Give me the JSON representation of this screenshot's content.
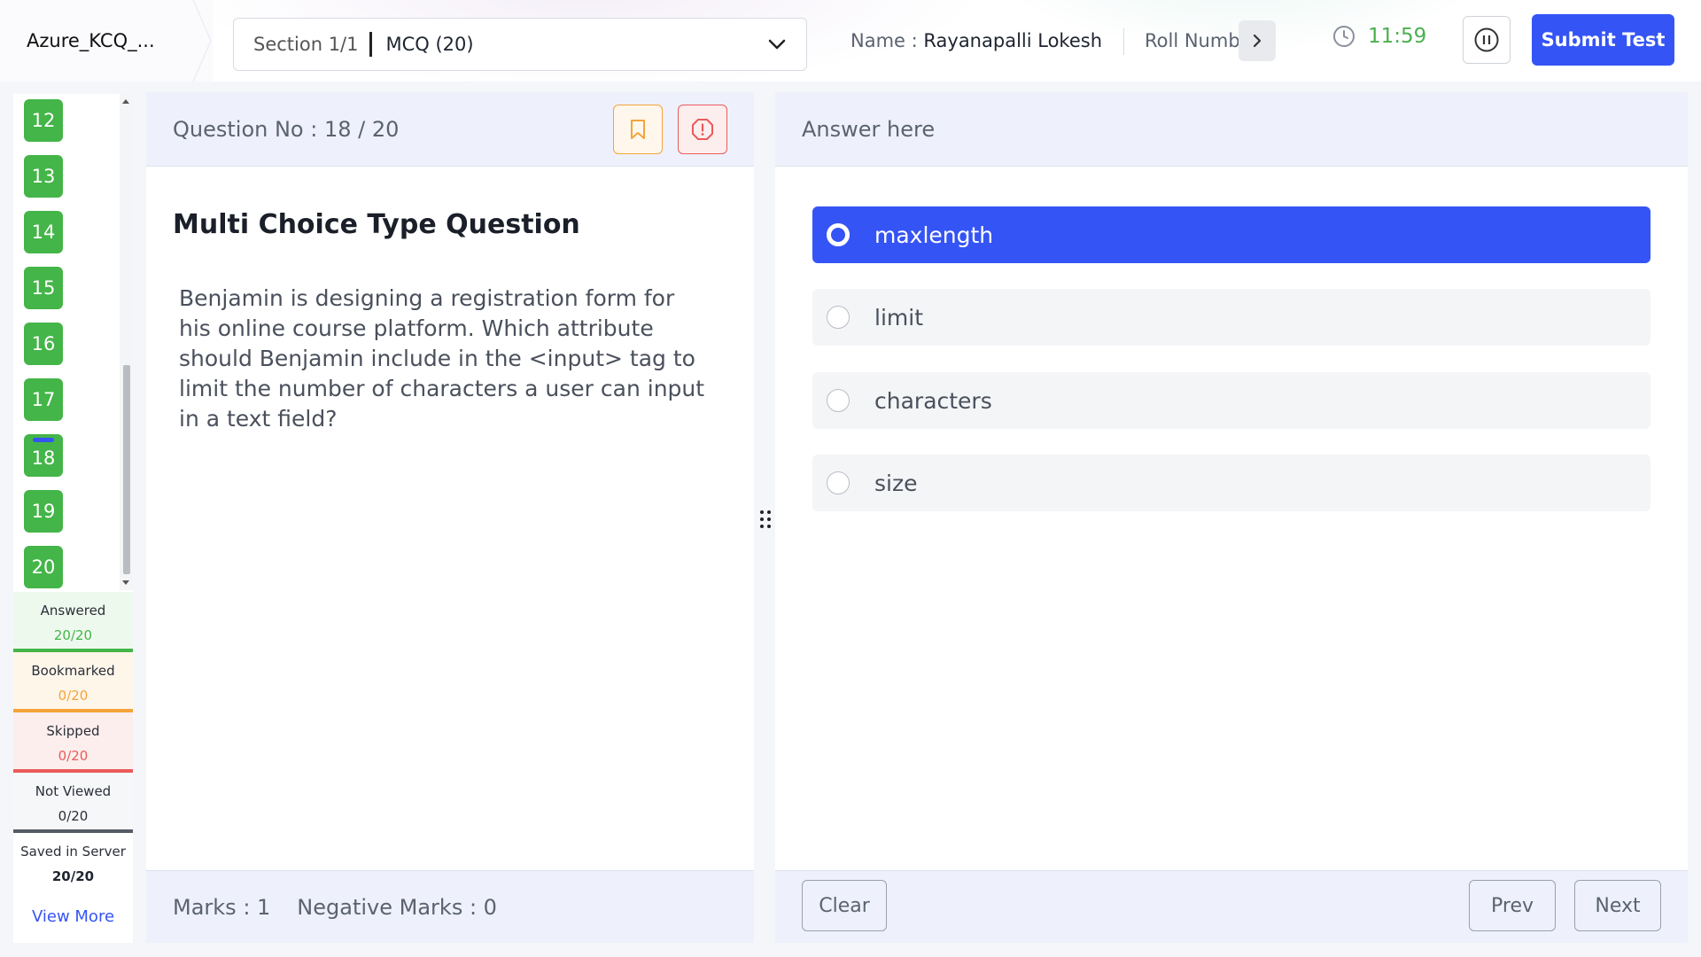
{
  "header": {
    "test_name": "Azure_KCQ_...",
    "section_label": "Section 1/1",
    "section_value": "MCQ (20)",
    "name_label": "Name : ",
    "name_value": "Rayanapalli Lokesh",
    "roll_label": "Roll Number",
    "timer": "11:59",
    "submit_label": "Submit Test"
  },
  "sidebar": {
    "questions": [
      {
        "number": "12",
        "current": false
      },
      {
        "number": "13",
        "current": false
      },
      {
        "number": "14",
        "current": false
      },
      {
        "number": "15",
        "current": false
      },
      {
        "number": "16",
        "current": false
      },
      {
        "number": "17",
        "current": false
      },
      {
        "number": "18",
        "current": true
      },
      {
        "number": "19",
        "current": false
      },
      {
        "number": "20",
        "current": false
      }
    ],
    "stats": {
      "answered": {
        "label": "Answered",
        "value": "20/20"
      },
      "bookmarked": {
        "label": "Bookmarked",
        "value": "0/20"
      },
      "skipped": {
        "label": "Skipped",
        "value": "0/20"
      },
      "not_viewed": {
        "label": "Not Viewed",
        "value": "0/20"
      },
      "saved": {
        "label": "Saved in Server",
        "value": "20/20"
      }
    },
    "view_more": "View More"
  },
  "question": {
    "number_label": "Question No : 18 / 20",
    "type": "Multi Choice Type Question",
    "text": "Benjamin is designing a registration form for his online course platform. Which attribute should Benjamin include in the <input> tag to limit the number of characters a user can input in a text field?",
    "marks": "Marks : 1",
    "negative_marks": "Negative Marks : 0"
  },
  "answer": {
    "title": "Answer here",
    "options": [
      {
        "label": "maxlength",
        "selected": true
      },
      {
        "label": "limit",
        "selected": false
      },
      {
        "label": "characters",
        "selected": false
      },
      {
        "label": "size",
        "selected": false
      }
    ],
    "clear_label": "Clear",
    "prev_label": "Prev",
    "next_label": "Next"
  },
  "colors": {
    "accent": "#3554f5",
    "answered": "#44b548",
    "bookmarked": "#f5a33a",
    "skipped": "#ea5a5a"
  }
}
